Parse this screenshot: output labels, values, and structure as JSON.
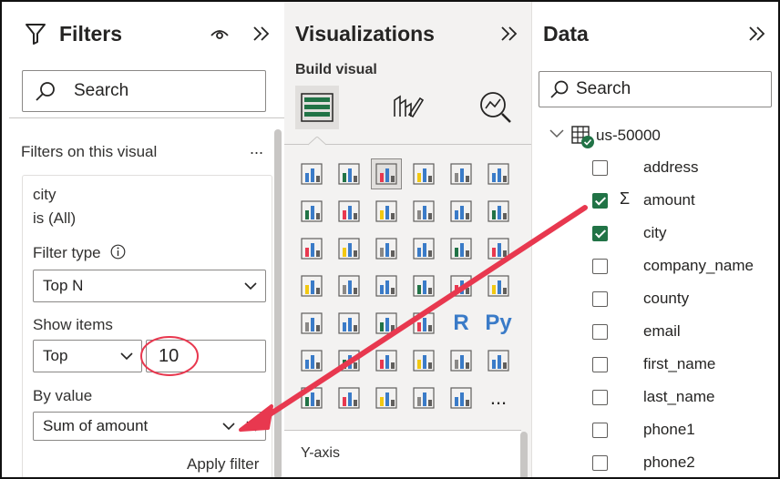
{
  "filters": {
    "title": "Filters",
    "search_placeholder": "Search",
    "section_title": "Filters on this visual",
    "more": "...",
    "card": {
      "field": "city",
      "state": "is (All)",
      "filter_type_label": "Filter type",
      "filter_type_value": "Top N",
      "show_items_label": "Show items",
      "show_items_direction": "Top",
      "show_items_count": "10",
      "by_value_label": "By value",
      "by_value_value": "Sum of amount",
      "apply_label": "Apply filter"
    }
  },
  "visualizations": {
    "title": "Visualizations",
    "build_visual_label": "Build visual",
    "r_label": "R",
    "py_label": "Py",
    "more": "...",
    "yaxis_label": "Y-axis",
    "tile_icons": [
      "stacked-bar-chart-icon",
      "stacked-column-chart-icon",
      "clustered-bar-chart-icon",
      "clustered-column-chart-icon",
      "100-stacked-bar-chart-icon",
      "100-stacked-column-chart-icon",
      "line-chart-icon",
      "area-chart-icon",
      "stacked-area-chart-icon",
      "line-and-column-chart-icon",
      "line-and-clustered-column-chart-icon",
      "ribbon-chart-icon",
      "waterfall-chart-icon",
      "funnel-chart-icon",
      "scatter-chart-icon",
      "pie-chart-icon",
      "donut-chart-icon",
      "treemap-icon",
      "map-icon",
      "filled-map-icon",
      "azure-map-icon",
      "gauge-icon",
      "card-icon",
      "multi-row-card-icon",
      "kpi-icon",
      "slicer-icon",
      "table-icon",
      "matrix-icon",
      "r-script-visual-icon",
      "python-visual-icon",
      "key-influencers-icon",
      "decomposition-tree-icon",
      "qa-icon",
      "smart-narrative-icon",
      "paginated-report-icon",
      "metrics-icon",
      "power-apps-icon",
      "power-automate-icon",
      "arcgis-map-icon",
      "power-apps-purple-icon",
      "power-automate-flow-icon",
      "more-visuals-icon"
    ]
  },
  "data": {
    "title": "Data",
    "search_placeholder": "Search",
    "table_name": "us-50000",
    "fields": [
      {
        "name": "address",
        "checked": false,
        "sigma": false
      },
      {
        "name": "amount",
        "checked": true,
        "sigma": true,
        "sigma_symbol": "Σ"
      },
      {
        "name": "city",
        "checked": true,
        "sigma": false
      },
      {
        "name": "company_name",
        "checked": false,
        "sigma": false
      },
      {
        "name": "county",
        "checked": false,
        "sigma": false
      },
      {
        "name": "email",
        "checked": false,
        "sigma": false
      },
      {
        "name": "first_name",
        "checked": false,
        "sigma": false
      },
      {
        "name": "last_name",
        "checked": false,
        "sigma": false
      },
      {
        "name": "phone1",
        "checked": false,
        "sigma": false
      },
      {
        "name": "phone2",
        "checked": false,
        "sigma": false
      }
    ]
  },
  "colors": {
    "accent_green": "#217346",
    "annotation_red": "#e8384f"
  }
}
